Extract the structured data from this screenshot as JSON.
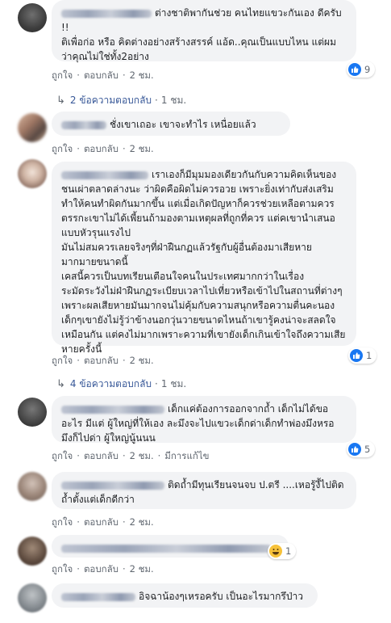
{
  "common": {
    "like_label": "ถูกใจ",
    "reply_label": "ตอบกลับ",
    "separator": "·"
  },
  "colors": {
    "bubble": "#f2f3f5",
    "link": "#385898",
    "like_blue": "#1877f2",
    "muted": "#606770"
  },
  "comments": [
    {
      "text": "ต่างชาติพากันช่วย คนไทยแขวะกันเอง ดีครับ !!\nติเพื่อก่อ หรือ คิดต่างอย่างสร้างสรรค์ แอ้ด..คุณเป็นแบบไหน แต่ผมว่าคุณไม่ใช่ทั้ง2อย่าง",
      "time": "2 ชม.",
      "reaction": {
        "icon": "like-icon",
        "count": "9"
      },
      "replies": {
        "label": "2 ข้อความตอบกลับ",
        "time": "1 ชม."
      }
    },
    {
      "text": "ชั่งเขาเถอะ เขาจะทำไร เหนื่อยแล้ว",
      "time": "2 ชม."
    },
    {
      "text": "เราเองก็มีมุมมองเดียวกันกับความคิดเห็นของชนเผ่าตลาดล่างนะ ว่าผิดคือผิดไม่ควรอวย เพราะยิ่งเท่ากับส่งเสริมทำให้คนทำผิดกันมากขึ้น แต่เมื่อเกิดปัญหาก็ควรช่วยเหลือตามควร ตรรกะเขาไม่ได้เพี้ยนถ้ามองตามเหตุผลที่ถูกที่ควร แต่คเขานำเสนอแบบหัวรุนแรงไป\nมันไม่สมควรเลยจริงๆที่ฝ่าฝืนกฏแล้วรัฐกับผู้อื่นต้องมาเสียหายมากมายขนาดนี้\nเคสนี้ควรเป็นบทเรียนเตือนใจคนในประเทศมากกว่าในเรื่องระมัดระวังไม่ฝ่าฝืนกฏระเบียบเวลาไปเที่ยวหรือเข้าไปในสถานที่ต่างๆ เพราะผลเสียหายมันมากจนไม่คุ้มกับความสนุกหรือความตื่นคะนอง\nเด็กๆเขายังไม่รู้ว่าข้างนอกวุ่นวายขนาดไหนถ้าเขารู้คงน่าจะสลดใจเหมือนกัน แต่คงไม่มากเพราะความที่เขายังเด็กเกินเข้าใจถึงความเสียหายครั้งนี้",
      "time": "2 ชม.",
      "reaction": {
        "icon": "like-icon",
        "count": "1"
      },
      "replies": {
        "label": "4 ข้อความตอบกลับ",
        "time": "1 ชม."
      }
    },
    {
      "text": "เด็กแค่ต้องการออกจากถ้ำ เด็กไม่ได้ขออะไร มีแต่ ผู้ใหญ่ที่ให้เอง ละมึงจะไปแขวะเด็กด่าเด็กทำพ่องมึงหรอ มึงก็ไปด่า ผู้ใหญ่นู้นนน",
      "time": "2 ชม.",
      "edited": "มีการแก้ไข",
      "reaction": {
        "icon": "like-icon",
        "count": "5"
      }
    },
    {
      "text": "ติดถ้ำมีทุนเรียนจนจบ ป.ตรี ....เหอรู้งี้ไปติดถ้ำตั้งแต่เด็กดีกว่า",
      "time": "2 ชม."
    },
    {
      "text": "",
      "time": "2 ชม.",
      "reaction": {
        "icon": "haha-icon",
        "count": "1"
      }
    },
    {
      "text": "อิจฉาน้องๆเหรอครับ เป็นอะไรมากรึป่าว",
      "time": ""
    }
  ]
}
